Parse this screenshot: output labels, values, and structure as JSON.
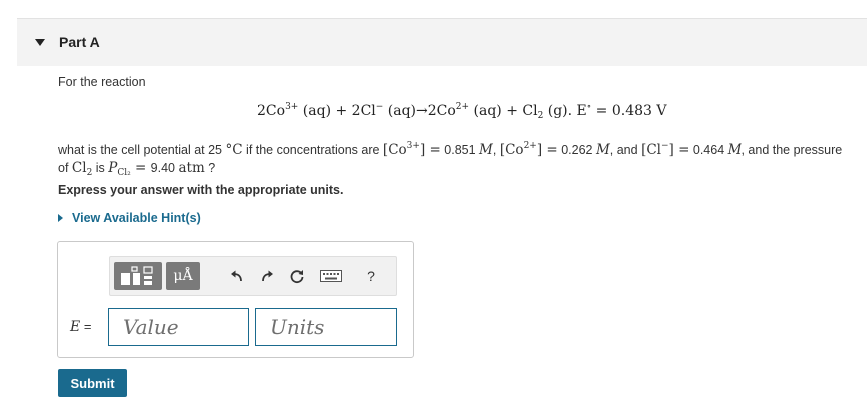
{
  "part": {
    "title": "Part A"
  },
  "intro_text": "For the reaction",
  "equation": {
    "t1": "2Co",
    "s1": "3+",
    "t2": " (aq) + 2Cl",
    "s2": "−",
    "t3": " (aq)→2Co",
    "s3": "2+",
    "t4": " (aq) + Cl",
    "b1": "2",
    "t5": " (g).  E",
    "s4": "∘",
    "t6": " = 0.483 V"
  },
  "question": {
    "q1": "what is the cell potential at 25 ",
    "q2": "°C",
    "q3": " if the concentrations are ",
    "q4": "[Co",
    "q5": "3+",
    "q6": "] =",
    "q7": " 0.851 ",
    "q8": "M",
    "q9": ", ",
    "q10": "[Co",
    "q11": "2+",
    "q12": "] =",
    "q13": " 0.262 ",
    "q14": "M",
    "q15": ", and ",
    "q16": "[Cl",
    "q17": "−",
    "q18": "] =",
    "q19": " 0.464 ",
    "q20": "M",
    "q21": ", and the pressure of ",
    "q22": "Cl",
    "q23": "2",
    "q24": " is ",
    "q25": "P",
    "q26": "Cl₂",
    "q27": " = ",
    "q28": "9.40 ",
    "q29": "atm",
    "q30": " ?"
  },
  "instructions": "Express your answer with the appropriate units.",
  "hint_link": "View Available Hint(s)",
  "toolbar": {
    "units_button": "μÅ",
    "help_label": "?",
    "icons": [
      "templates-icon",
      "units-icon",
      "undo-icon",
      "redo-icon",
      "reset-icon",
      "keyboard-icon",
      "help-icon"
    ]
  },
  "answer": {
    "variable": "E",
    "equals": " =",
    "value_placeholder": "Value",
    "units_placeholder": "Units"
  },
  "submit_label": "Submit",
  "colors": {
    "accent": "#1a6a8e",
    "header_bg": "#f3f3f3",
    "toolbar_btn": "#7a7a7a"
  }
}
